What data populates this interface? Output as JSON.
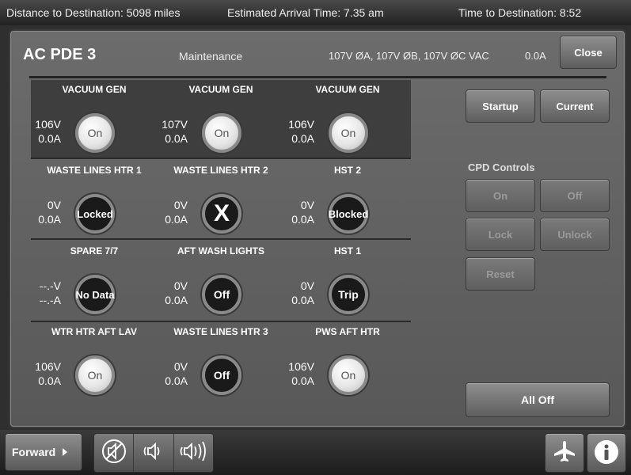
{
  "status": {
    "distance": "Distance to Destination: 5098 miles",
    "arrival": "Estimated Arrival Time: 7.35 am",
    "time_to_dest": "Time to Destination: 8:52"
  },
  "header": {
    "title": "AC PDE 3",
    "mode": "Maintenance",
    "voltages": "107V ØA, 107V ØB, 107V ØC  VAC",
    "current": "0.0A",
    "close_label": "Close"
  },
  "actions": {
    "startup_label": "Startup",
    "current_label": "Current"
  },
  "cpd": {
    "label": "CPD Controls",
    "on": "On",
    "off": "Off",
    "lock": "Lock",
    "unlock": "Unlock",
    "reset": "Reset"
  },
  "all_off_label": "All Off",
  "circuits": [
    [
      {
        "name": "VACUUM GEN",
        "v": "106V",
        "a": "0.0A",
        "state": "On"
      },
      {
        "name": "VACUUM GEN",
        "v": "107V",
        "a": "0.0A",
        "state": "On"
      },
      {
        "name": "VACUUM GEN",
        "v": "106V",
        "a": "0.0A",
        "state": "On"
      }
    ],
    [
      {
        "name": "WASTE LINES HTR 1",
        "v": "0V",
        "a": "0.0A",
        "state": "Locked"
      },
      {
        "name": "WASTE LINES HTR 2",
        "v": "0V",
        "a": "0.0A",
        "state": "X"
      },
      {
        "name": "HST 2",
        "v": "0V",
        "a": "0.0A",
        "state": "Blocked"
      }
    ],
    [
      {
        "name": "SPARE 7/7",
        "v": "--.-V",
        "a": "--.-A",
        "state": "No Data"
      },
      {
        "name": "AFT WASH LIGHTS",
        "v": "0V",
        "a": "0.0A",
        "state": "Off"
      },
      {
        "name": "HST 1",
        "v": "0V",
        "a": "0.0A",
        "state": "Trip"
      }
    ],
    [
      {
        "name": "WTR HTR AFT LAV",
        "v": "106V",
        "a": "0.0A",
        "state": "On"
      },
      {
        "name": "WASTE LINES HTR 3",
        "v": "0V",
        "a": "0.0A",
        "state": "Off"
      },
      {
        "name": "PWS AFT HTR",
        "v": "106V",
        "a": "0.0A",
        "state": "On"
      }
    ]
  ],
  "bottom": {
    "forward_label": "Forward",
    "icons": [
      "mute-icon",
      "volume-low-icon",
      "volume-high-icon",
      "airplane-icon",
      "info-icon"
    ]
  }
}
